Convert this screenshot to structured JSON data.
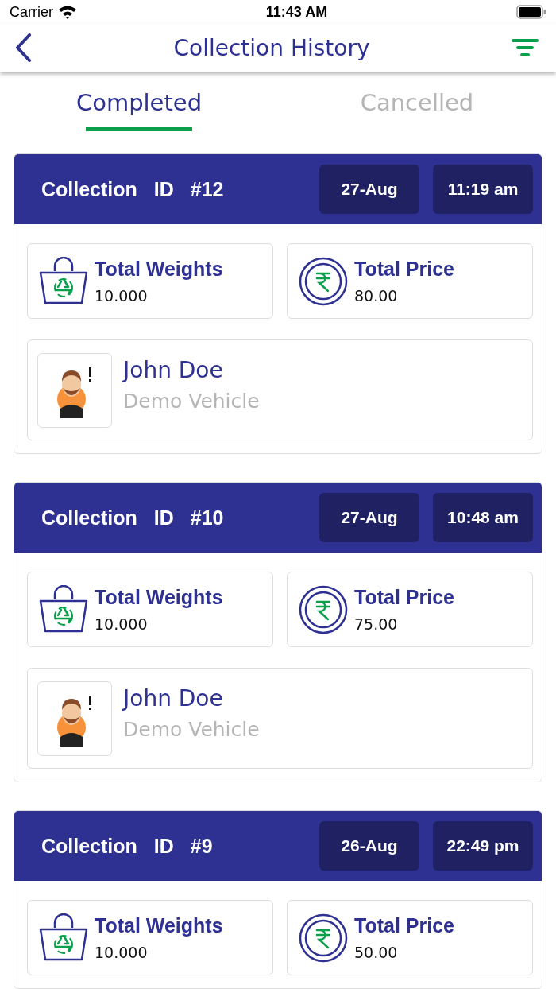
{
  "status_bar": {
    "carrier": "Carrier",
    "time": "11:43 AM"
  },
  "header": {
    "title": "Collection History"
  },
  "tabs": [
    {
      "label": "Completed",
      "selected": true
    },
    {
      "label": "Cancelled",
      "selected": false
    }
  ],
  "collections": [
    {
      "id_label": "Collection ID",
      "id": "#12",
      "date": "27-Aug",
      "time": "11:19 am",
      "weight_label": "Total Weights",
      "weight": "10.000",
      "price_label": "Total Price",
      "price": "80.00",
      "name": "John Doe",
      "vehicle": "Demo Vehicle"
    },
    {
      "id_label": "Collection ID",
      "id": "#10",
      "date": "27-Aug",
      "time": "10:48 am",
      "weight_label": "Total Weights",
      "weight": "10.000",
      "price_label": "Total Price",
      "price": "75.00",
      "name": "John Doe",
      "vehicle": "Demo Vehicle"
    },
    {
      "id_label": "Collection ID",
      "id": "#9",
      "date": "26-Aug",
      "time": "22:49 pm",
      "weight_label": "Total Weights",
      "weight": "10.000",
      "price_label": "Total Price",
      "price": "50.00"
    }
  ]
}
